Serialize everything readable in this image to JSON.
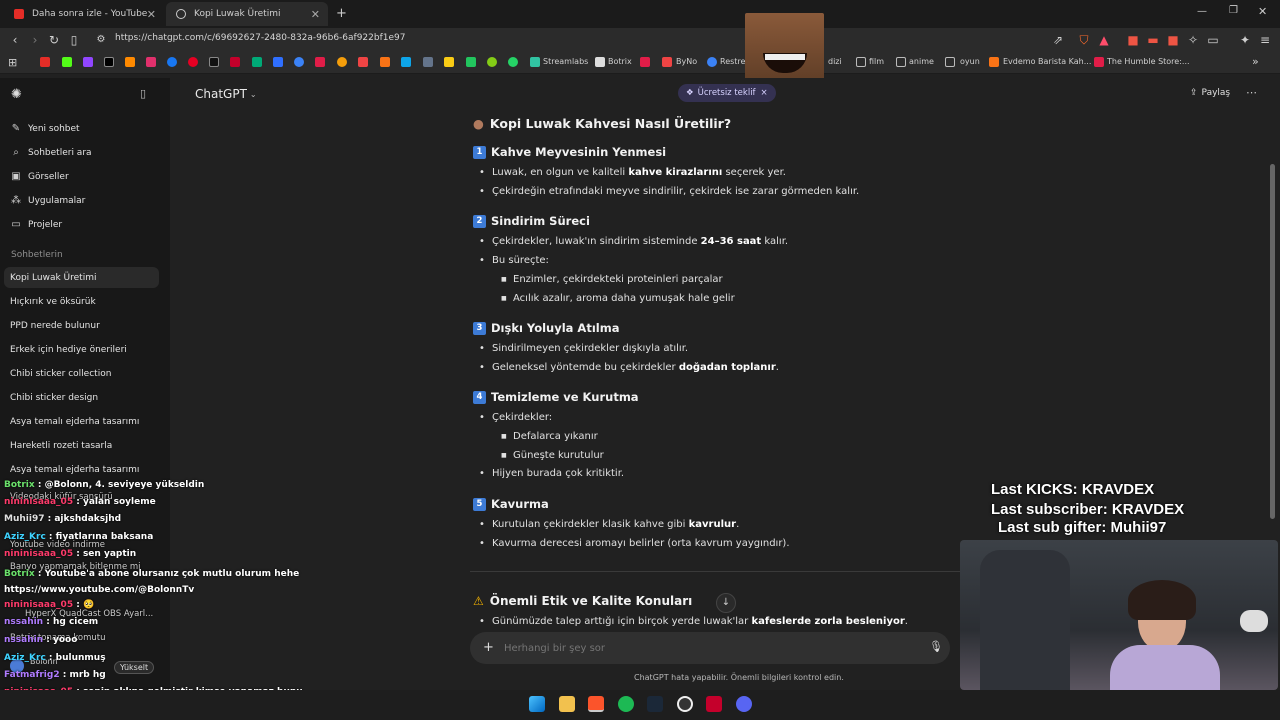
{
  "browser": {
    "tabs": [
      {
        "title": "Daha sonra izle - YouTube",
        "active": false
      },
      {
        "title": "Kopi Luwak Üretimi",
        "active": true
      }
    ],
    "url": "https://chatgpt.com/c/69692627-2480-832a-96b6-6af922bf1e97",
    "new_tab": "+",
    "bookmarks": {
      "streamlabs": "Streamlabs",
      "botrix": "Botrix",
      "byno": "ByNo",
      "restream": "Restream",
      "dizi": "dizi",
      "film": "film",
      "anime": "anime",
      "oyun": "oyun",
      "evdemo": "Evdemo Barista Kah...",
      "humble": "The Humble Store:..."
    }
  },
  "sidebar": {
    "actions": [
      {
        "label": "Yeni sohbet",
        "icon": "edit-icon"
      },
      {
        "label": "Sohbetleri ara",
        "icon": "search-icon"
      },
      {
        "label": "Görseller",
        "icon": "image-icon"
      },
      {
        "label": "Uygulamalar",
        "icon": "apps-icon"
      },
      {
        "label": "Projeler",
        "icon": "folder-icon"
      }
    ],
    "section_title": "Sohbetlerin",
    "chats": [
      "Kopi Luwak Üretimi",
      "Hıçkırık ve öksürük",
      "PPD nerede bulunur",
      "Erkek için hediye önerileri",
      "Chibi sticker collection",
      "Chibi sticker design",
      "Asya temalı ejderha tasarımı",
      "Hareketli rozeti tasarla",
      "Asya temalı ejderha tasarımı"
    ],
    "upgrade_label": "Yükselt",
    "user_name": "Bolonn"
  },
  "header": {
    "model": "ChatGPT",
    "offer_label": "Ücretsiz teklif",
    "share_label": "Paylaş"
  },
  "content": {
    "title": "Kopi Luwak Kahvesi Nasıl Üretilir?",
    "s1": {
      "num": "1",
      "title": "Kahve Meyvesinin Yenmesi",
      "b1_pre": "Luwak, en olgun ve kaliteli ",
      "b1_bold": "kahve kirazlarını",
      "b1_post": " seçerek yer.",
      "b2": "Çekirdeğin etrafındaki meyve sindirilir, çekirdek ise zarar görmeden kalır."
    },
    "s2": {
      "num": "2",
      "title": "Sindirim Süreci",
      "b1_pre": "Çekirdekler, luwak'ın sindirim sisteminde ",
      "b1_bold": "24–36 saat",
      "b1_post": " kalır.",
      "b2": "Bu süreçte:",
      "b2a": "Enzimler, çekirdekteki proteinleri parçalar",
      "b2b": "Acılık azalır, aroma daha yumuşak hale gelir"
    },
    "s3": {
      "num": "3",
      "title": "Dışkı Yoluyla Atılma",
      "b1": "Sindirilmeyen çekirdekler dışkıyla atılır.",
      "b2_pre": "Geleneksel yöntemde bu çekirdekler ",
      "b2_bold": "doğadan toplanır",
      "b2_post": "."
    },
    "s4": {
      "num": "4",
      "title": "Temizleme ve Kurutma",
      "b1": "Çekirdekler:",
      "b1a": "Defalarca yıkanır",
      "b1b": "Güneşte kurutulur",
      "b2": "Hijyen burada çok kritiktir."
    },
    "s5": {
      "num": "5",
      "title": "Kavurma",
      "b1_pre": "Kurutulan çekirdekler klasik kahve gibi ",
      "b1_bold": "kavrulur",
      "b1_post": ".",
      "b2": "Kavurma derecesi aromayı belirler (orta kavrum yaygındır)."
    },
    "ethics": {
      "title": "Önemli Etik ve Kalite Konuları",
      "b1_pre": "Günümüzde talep arttığı için birçok yerde luwak'lar ",
      "b1_bold": "kafeslerde zorla besleniyor",
      "b1_post": "."
    }
  },
  "composer": {
    "placeholder": "Herhangi bir şey sor",
    "disclaimer": "ChatGPT hata yapabilir. Önemli bilgileri kontrol edin."
  },
  "stream_overlay": {
    "chat": [
      {
        "user": "Botrix",
        "msg": "@Bolonn, 4. seviyeye yükseldin",
        "color": "#6be26b"
      },
      {
        "user": "nininisaaa_05",
        "msg": "yalan soyleme",
        "color": "#ff3b6b"
      },
      {
        "user": "Muhii97",
        "msg": "ajkshdaksjhd",
        "color": "#e0e0e0"
      },
      {
        "user": "Aziz_Krc",
        "msg": "fiyatlarına baksana",
        "color": "#3fd3ff"
      },
      {
        "user": "nininisaaa_05",
        "msg": "sen yaptin",
        "color": "#ff3b6b"
      },
      {
        "user": "Botrix",
        "msg": "Youtube'a abone olursanız çok mutlu olurum hehe https://www.youtube.com/@BolonnTv",
        "color": "#6be26b"
      },
      {
        "user": "nininisaaa_05",
        "msg": "🥺",
        "color": "#ff3b6b"
      },
      {
        "user": "nssahin",
        "msg": "hg cicem",
        "color": "#b07cff"
      },
      {
        "user": "nssahin",
        "msg": "yooo",
        "color": "#b07cff"
      },
      {
        "user": "Aziz_Krc",
        "msg": "bulunmuş",
        "color": "#3fd3ff"
      },
      {
        "user": "Fatmafrig2",
        "msg": "mrb hg",
        "color": "#b07cff"
      },
      {
        "user": "nininisaaa_05",
        "msg": "senin aklına gelmiştir kimse yapamaz bunu",
        "color": "#ff3b6b"
      }
    ],
    "ghost_lines": [
      "Videodaki küfür sansürü",
      "Youtube video indirme",
      "Banyo yapmamak bitlenme mi",
      "HyperX QuadCast OBS Ayarl...",
      "Botrix tonama komutu"
    ],
    "stats": {
      "kicks": "Last KICKS: KRAVDEX",
      "sub": "Last subscriber: KRAVDEX",
      "gifter": "Last sub gifter: Muhii97"
    }
  },
  "colors": {
    "accent_blue": "#3d7bd6",
    "bg_main": "#212121",
    "bg_sidebar": "#181818"
  }
}
